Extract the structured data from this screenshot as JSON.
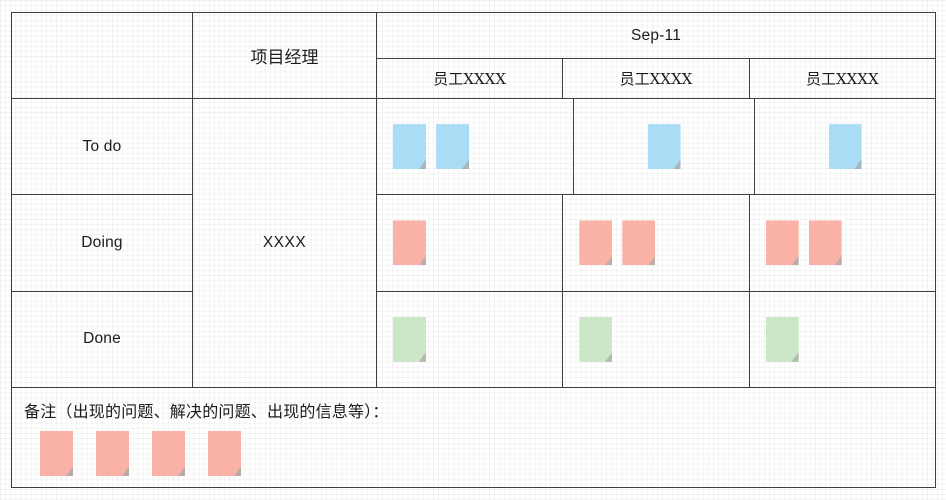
{
  "board": {
    "status_header_blank": "",
    "project_manager": {
      "header": "项目经理",
      "value": "XXXX"
    },
    "date_group": {
      "title": "Sep-11",
      "people": [
        {
          "name": "员工XXXX"
        },
        {
          "name": "员工XXXX"
        },
        {
          "name": "员工XXXX"
        }
      ]
    },
    "rows": [
      {
        "status": "To do",
        "note_color": "blue",
        "align": [
          "left",
          "center",
          "center"
        ],
        "counts": [
          2,
          1,
          1
        ]
      },
      {
        "status": "Doing",
        "note_color": "pink",
        "align": [
          "left",
          "left",
          "left"
        ],
        "counts": [
          1,
          2,
          2
        ]
      },
      {
        "status": "Done",
        "note_color": "green",
        "align": [
          "left",
          "left",
          "left"
        ],
        "counts": [
          1,
          1,
          1
        ]
      }
    ],
    "remarks": {
      "label": "备注（出现的问题、解决的问题、出现的信息等）：",
      "note_color": "pink",
      "count": 4
    }
  },
  "colors": {
    "border": "#3f3f43",
    "text": "#1b1b1f",
    "note_blue": "#aadcf5",
    "note_pink": "#fab1a6",
    "note_green": "#cbe7c8",
    "grid_line": "rgba(0,0,0,0.045)",
    "page_background": "#ffffff"
  }
}
